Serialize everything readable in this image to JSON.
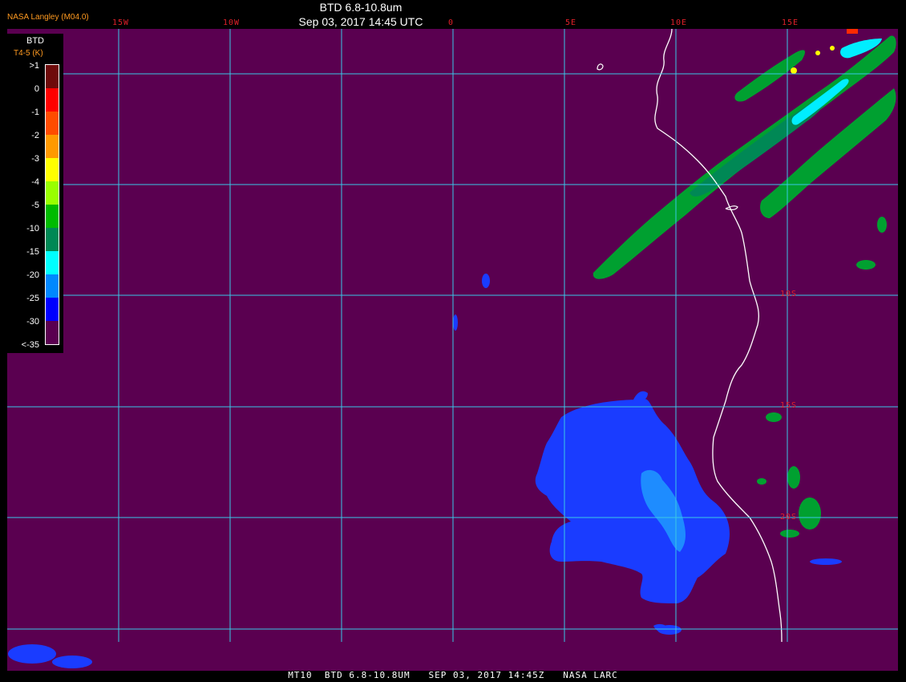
{
  "header": {
    "title": "BTD 6.8-10.8um",
    "subtitle": "Sep 03, 2017 14:45 UTC",
    "source": "NASA Langley (M04.0)"
  },
  "legend": {
    "title": "BTD",
    "unit": "T4-5 (K)",
    "labels": [
      ">1",
      "0",
      "-1",
      "-2",
      "-3",
      "-4",
      "-5",
      "-10",
      "-15",
      "-20",
      "-25",
      "-30",
      "<-35"
    ],
    "colors": [
      "#6e0a0a",
      "#ff0000",
      "#ff4c00",
      "#ff9900",
      "#ffff00",
      "#99ff00",
      "#00bb00",
      "#008855",
      "#00ffff",
      "#0088ff",
      "#0000ff",
      "#5a0050"
    ]
  },
  "grid": {
    "lon_labels": [
      "15W",
      "10W",
      "0",
      "5E",
      "10E",
      "15E"
    ],
    "lat_labels": [
      "10S",
      "15S",
      "20S"
    ],
    "line_color": "#39c8e6"
  },
  "footer": "MT10  BTD 6.8-10.8UM   SEP 03, 2017 14:45Z   NASA LARC",
  "colors": {
    "background": "#5a0050",
    "coast": "#ffffff",
    "cloud_blue": "#1a3cff",
    "cloud_light_blue": "#1e8cff",
    "cloud_green": "#00c020",
    "cloud_teal": "#008855",
    "cloud_cyan": "#00eeff",
    "cloud_yellow": "#ffff00"
  }
}
